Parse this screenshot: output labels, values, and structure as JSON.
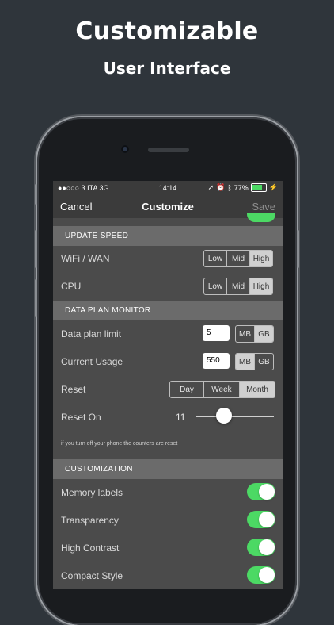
{
  "promo": {
    "title": "Customizable",
    "subtitle": "User Interface"
  },
  "status_bar": {
    "carrier": "●●○○○ 3 ITA  3G",
    "time": "14:14",
    "battery": "77%",
    "battery_level": 0.77
  },
  "nav": {
    "cancel": "Cancel",
    "title": "Customize",
    "save": "Save"
  },
  "update_speed": {
    "header": "UPDATE SPEED",
    "rows": [
      {
        "label": "WiFi / WAN",
        "options": [
          "Low",
          "Mid",
          "High"
        ],
        "selected": "High"
      },
      {
        "label": "CPU",
        "options": [
          "Low",
          "Mid",
          "High"
        ],
        "selected": "High"
      }
    ]
  },
  "data_plan": {
    "header": "DATA PLAN MONITOR",
    "limit": {
      "label": "Data plan limit",
      "value": "5",
      "units": [
        "MB",
        "GB"
      ],
      "selected": "GB"
    },
    "usage": {
      "label": "Current Usage",
      "value": "550",
      "units": [
        "MB",
        "GB"
      ],
      "selected": "MB"
    },
    "reset": {
      "label": "Reset",
      "options": [
        "Day",
        "Week",
        "Month"
      ],
      "selected": "Month"
    },
    "reset_on": {
      "label": "Reset On",
      "value": "11"
    },
    "note": "if you turn off your phone the counters are reset"
  },
  "customization": {
    "header": "CUSTOMIZATION",
    "toggles": [
      {
        "label": "Memory labels",
        "on": true
      },
      {
        "label": "Transparency",
        "on": true
      },
      {
        "label": "High Contrast",
        "on": true
      },
      {
        "label": "Compact Style",
        "on": true
      }
    ]
  },
  "colors": {
    "toggle_on": "#4cd964",
    "background": "#2f353b"
  }
}
